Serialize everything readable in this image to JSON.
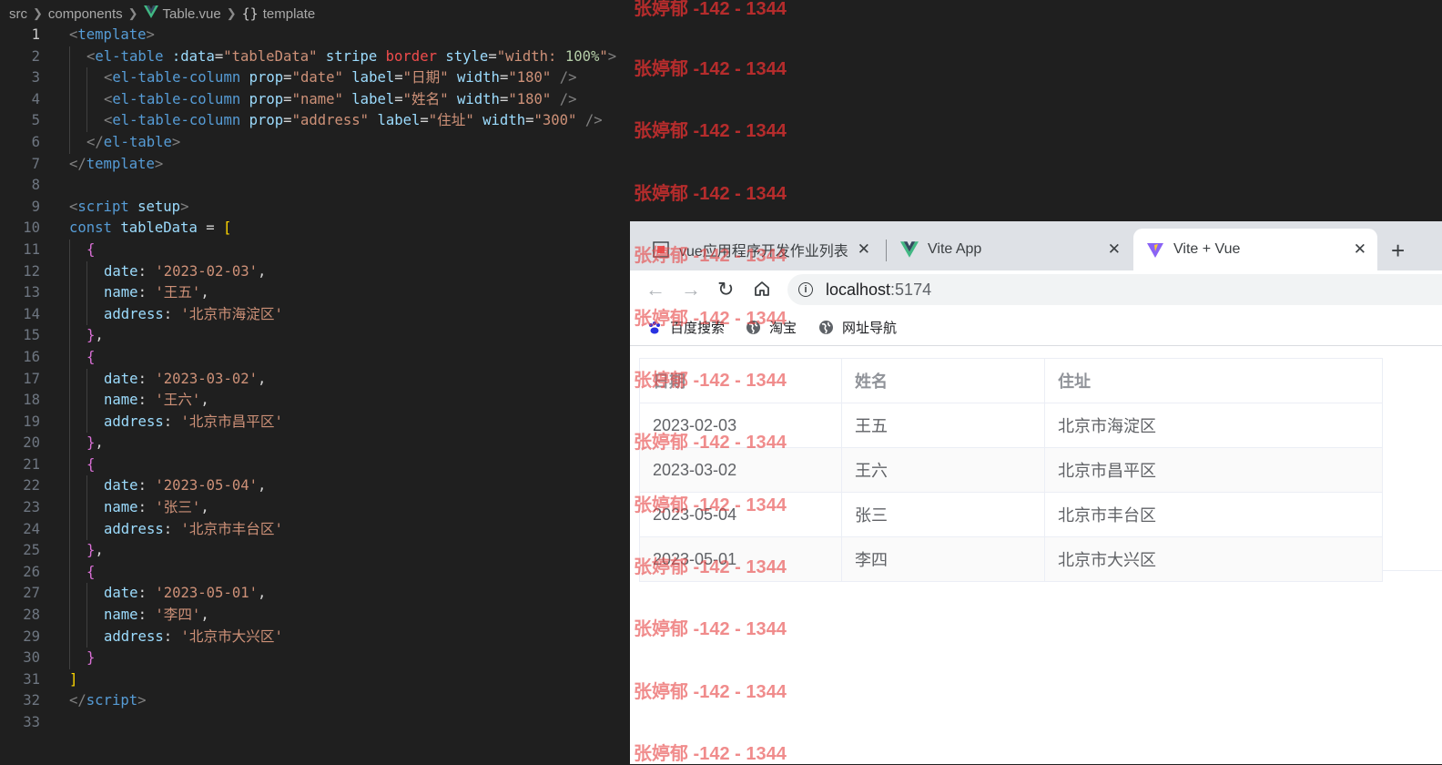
{
  "editor": {
    "breadcrumb": [
      "src",
      "components",
      "Table.vue",
      "template"
    ],
    "active_line": 1,
    "lines": [
      {
        "n": 1,
        "ind": 0,
        "t": [
          [
            "t-br",
            "<"
          ],
          [
            "t-tag",
            "template"
          ],
          [
            "t-br",
            ">"
          ]
        ]
      },
      {
        "n": 2,
        "ind": 1,
        "t": [
          [
            "t-br",
            "<"
          ],
          [
            "t-tag",
            "el-table"
          ],
          [
            "t-pun",
            " "
          ],
          [
            "t-attr",
            ":data"
          ],
          [
            "t-pun",
            "="
          ],
          [
            "t-str",
            "\"tableData\""
          ],
          [
            "t-pun",
            " "
          ],
          [
            "t-attr",
            "stripe"
          ],
          [
            "t-pun",
            " "
          ],
          [
            "t-red",
            "border"
          ],
          [
            "t-pun",
            " "
          ],
          [
            "t-attr",
            "style"
          ],
          [
            "t-pun",
            "="
          ],
          [
            "t-str",
            "\"width: "
          ],
          [
            "t-num",
            "100%"
          ],
          [
            "t-str",
            "\""
          ],
          [
            "t-br",
            ">"
          ]
        ]
      },
      {
        "n": 3,
        "ind": 2,
        "t": [
          [
            "t-br",
            "<"
          ],
          [
            "t-tag",
            "el-table-column"
          ],
          [
            "t-pun",
            " "
          ],
          [
            "t-attr",
            "prop"
          ],
          [
            "t-pun",
            "="
          ],
          [
            "t-str",
            "\"date\""
          ],
          [
            "t-pun",
            " "
          ],
          [
            "t-attr",
            "label"
          ],
          [
            "t-pun",
            "="
          ],
          [
            "t-str",
            "\"日期\""
          ],
          [
            "t-pun",
            " "
          ],
          [
            "t-attr",
            "width"
          ],
          [
            "t-pun",
            "="
          ],
          [
            "t-str",
            "\"180\""
          ],
          [
            "t-pun",
            " "
          ],
          [
            "t-br",
            "/>"
          ]
        ]
      },
      {
        "n": 4,
        "ind": 2,
        "t": [
          [
            "t-br",
            "<"
          ],
          [
            "t-tag",
            "el-table-column"
          ],
          [
            "t-pun",
            " "
          ],
          [
            "t-attr",
            "prop"
          ],
          [
            "t-pun",
            "="
          ],
          [
            "t-str",
            "\"name\""
          ],
          [
            "t-pun",
            " "
          ],
          [
            "t-attr",
            "label"
          ],
          [
            "t-pun",
            "="
          ],
          [
            "t-str",
            "\"姓名\""
          ],
          [
            "t-pun",
            " "
          ],
          [
            "t-attr",
            "width"
          ],
          [
            "t-pun",
            "="
          ],
          [
            "t-str",
            "\"180\""
          ],
          [
            "t-pun",
            " "
          ],
          [
            "t-br",
            "/>"
          ]
        ]
      },
      {
        "n": 5,
        "ind": 2,
        "t": [
          [
            "t-br",
            "<"
          ],
          [
            "t-tag",
            "el-table-column"
          ],
          [
            "t-pun",
            " "
          ],
          [
            "t-attr",
            "prop"
          ],
          [
            "t-pun",
            "="
          ],
          [
            "t-str",
            "\"address\""
          ],
          [
            "t-pun",
            " "
          ],
          [
            "t-attr",
            "label"
          ],
          [
            "t-pun",
            "="
          ],
          [
            "t-str",
            "\"住址\""
          ],
          [
            "t-pun",
            " "
          ],
          [
            "t-attr",
            "width"
          ],
          [
            "t-pun",
            "="
          ],
          [
            "t-str",
            "\"300\""
          ],
          [
            "t-pun",
            " "
          ],
          [
            "t-br",
            "/>"
          ]
        ]
      },
      {
        "n": 6,
        "ind": 1,
        "t": [
          [
            "t-br",
            "</"
          ],
          [
            "t-tag",
            "el-table"
          ],
          [
            "t-br",
            ">"
          ]
        ]
      },
      {
        "n": 7,
        "ind": 0,
        "t": [
          [
            "t-br",
            "</"
          ],
          [
            "t-tag",
            "template"
          ],
          [
            "t-br",
            ">"
          ]
        ]
      },
      {
        "n": 8,
        "ind": 0,
        "t": []
      },
      {
        "n": 9,
        "ind": 0,
        "t": [
          [
            "t-br",
            "<"
          ],
          [
            "t-tag",
            "script"
          ],
          [
            "t-pun",
            " "
          ],
          [
            "t-attr",
            "setup"
          ],
          [
            "t-br",
            ">"
          ]
        ]
      },
      {
        "n": 10,
        "ind": 0,
        "t": [
          [
            "t-kw",
            "const"
          ],
          [
            "t-pun",
            " "
          ],
          [
            "t-var",
            "tableData"
          ],
          [
            "t-pun",
            " = "
          ],
          [
            "t-b1",
            "["
          ]
        ]
      },
      {
        "n": 11,
        "ind": 1,
        "t": [
          [
            "t-b2",
            "{"
          ]
        ]
      },
      {
        "n": 12,
        "ind": 2,
        "t": [
          [
            "t-attr",
            "date"
          ],
          [
            "t-pun",
            ": "
          ],
          [
            "t-str",
            "'2023-02-03'"
          ],
          [
            "t-pun",
            ","
          ]
        ]
      },
      {
        "n": 13,
        "ind": 2,
        "t": [
          [
            "t-attr",
            "name"
          ],
          [
            "t-pun",
            ": "
          ],
          [
            "t-str",
            "'王五'"
          ],
          [
            "t-pun",
            ","
          ]
        ]
      },
      {
        "n": 14,
        "ind": 2,
        "t": [
          [
            "t-attr",
            "address"
          ],
          [
            "t-pun",
            ": "
          ],
          [
            "t-str",
            "'北京市海淀区'"
          ]
        ]
      },
      {
        "n": 15,
        "ind": 1,
        "t": [
          [
            "t-b2",
            "}"
          ],
          [
            "t-pun",
            ","
          ]
        ]
      },
      {
        "n": 16,
        "ind": 1,
        "t": [
          [
            "t-b2",
            "{"
          ]
        ]
      },
      {
        "n": 17,
        "ind": 2,
        "t": [
          [
            "t-attr",
            "date"
          ],
          [
            "t-pun",
            ": "
          ],
          [
            "t-str",
            "'2023-03-02'"
          ],
          [
            "t-pun",
            ","
          ]
        ]
      },
      {
        "n": 18,
        "ind": 2,
        "t": [
          [
            "t-attr",
            "name"
          ],
          [
            "t-pun",
            ": "
          ],
          [
            "t-str",
            "'王六'"
          ],
          [
            "t-pun",
            ","
          ]
        ]
      },
      {
        "n": 19,
        "ind": 2,
        "t": [
          [
            "t-attr",
            "address"
          ],
          [
            "t-pun",
            ": "
          ],
          [
            "t-str",
            "'北京市昌平区'"
          ]
        ]
      },
      {
        "n": 20,
        "ind": 1,
        "t": [
          [
            "t-b2",
            "}"
          ],
          [
            "t-pun",
            ","
          ]
        ]
      },
      {
        "n": 21,
        "ind": 1,
        "t": [
          [
            "t-b2",
            "{"
          ]
        ]
      },
      {
        "n": 22,
        "ind": 2,
        "t": [
          [
            "t-attr",
            "date"
          ],
          [
            "t-pun",
            ": "
          ],
          [
            "t-str",
            "'2023-05-04'"
          ],
          [
            "t-pun",
            ","
          ]
        ]
      },
      {
        "n": 23,
        "ind": 2,
        "t": [
          [
            "t-attr",
            "name"
          ],
          [
            "t-pun",
            ": "
          ],
          [
            "t-str",
            "'张三'"
          ],
          [
            "t-pun",
            ","
          ]
        ]
      },
      {
        "n": 24,
        "ind": 2,
        "t": [
          [
            "t-attr",
            "address"
          ],
          [
            "t-pun",
            ": "
          ],
          [
            "t-str",
            "'北京市丰台区'"
          ]
        ]
      },
      {
        "n": 25,
        "ind": 1,
        "t": [
          [
            "t-b2",
            "}"
          ],
          [
            "t-pun",
            ","
          ]
        ]
      },
      {
        "n": 26,
        "ind": 1,
        "t": [
          [
            "t-b2",
            "{"
          ]
        ]
      },
      {
        "n": 27,
        "ind": 2,
        "t": [
          [
            "t-attr",
            "date"
          ],
          [
            "t-pun",
            ": "
          ],
          [
            "t-str",
            "'2023-05-01'"
          ],
          [
            "t-pun",
            ","
          ]
        ]
      },
      {
        "n": 28,
        "ind": 2,
        "t": [
          [
            "t-attr",
            "name"
          ],
          [
            "t-pun",
            ": "
          ],
          [
            "t-str",
            "'李四'"
          ],
          [
            "t-pun",
            ","
          ]
        ]
      },
      {
        "n": 29,
        "ind": 2,
        "t": [
          [
            "t-attr",
            "address"
          ],
          [
            "t-pun",
            ": "
          ],
          [
            "t-str",
            "'北京市大兴区'"
          ]
        ]
      },
      {
        "n": 30,
        "ind": 1,
        "t": [
          [
            "t-b2",
            "}"
          ]
        ]
      },
      {
        "n": 31,
        "ind": 0,
        "t": [
          [
            "t-b1",
            "]"
          ]
        ]
      },
      {
        "n": 32,
        "ind": 0,
        "t": [
          [
            "t-br",
            "</"
          ],
          [
            "t-tag",
            "script"
          ],
          [
            "t-br",
            ">"
          ]
        ]
      },
      {
        "n": 33,
        "ind": 0,
        "t": []
      }
    ]
  },
  "browser": {
    "tabs": [
      {
        "title": "vue应用程序开发作业列表",
        "icon": "page-favicon",
        "active": false
      },
      {
        "title": "Vite App",
        "icon": "vue-favicon",
        "active": false
      },
      {
        "title": "Vite + Vue",
        "icon": "vite-favicon",
        "active": true
      }
    ],
    "new_tab_label": "+",
    "close_glyph": "✕",
    "url_host": "localhost",
    "url_port": ":5174",
    "bookmarks": [
      {
        "label": "百度搜索",
        "icon": "baidu-paw-icon"
      },
      {
        "label": "淘宝",
        "icon": "globe-icon"
      },
      {
        "label": "网址导航",
        "icon": "globe-icon"
      }
    ]
  },
  "table": {
    "headers": [
      "日期",
      "姓名",
      "住址"
    ],
    "rows": [
      [
        "2023-02-03",
        "王五",
        "北京市海淀区"
      ],
      [
        "2023-03-02",
        "王六",
        "北京市昌平区"
      ],
      [
        "2023-05-04",
        "张三",
        "北京市丰台区"
      ],
      [
        "2023-05-01",
        "李四",
        "北京市大兴区"
      ]
    ]
  },
  "watermark": {
    "text": "张婷郁 -142 - 1344"
  },
  "colors": {
    "editor_bg": "#1f1f1f",
    "tag": "#569cd6",
    "attribute": "#9cdcfe",
    "string": "#ce9178",
    "watermark": "#d73030",
    "vue_green": "#41b883"
  }
}
